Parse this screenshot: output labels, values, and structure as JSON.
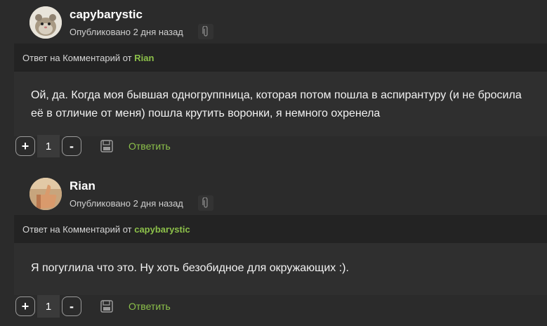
{
  "comments": [
    {
      "author": "capybarystic",
      "published": "Опубликовано 2 дня назад",
      "reply_prefix": "Ответ на Комментарий от ",
      "reply_to": "Rian",
      "text": "Ой, да. Когда моя бывшая одногруппница, которая потом пошла в аспирантуру (и не бросила её в отличие от меня) пошла крутить воронки, я немного охренела",
      "vote_plus": "+",
      "vote_count": "1",
      "vote_minus": "-",
      "reply_label": "Ответить"
    },
    {
      "author": "Rian",
      "published": "Опубликовано 2 дня назад",
      "reply_prefix": "Ответ на Комментарий от ",
      "reply_to": "capybarystic",
      "text": "Я погуглила что это. Ну хоть безобидное для окружающих :).",
      "vote_plus": "+",
      "vote_count": "1",
      "vote_minus": "-",
      "reply_label": "Ответить"
    }
  ],
  "colors": {
    "background": "#2b2b2b",
    "reply_bar": "#232323",
    "accent_green": "#8cc04a"
  },
  "icons": {
    "attachment": "paperclip-icon",
    "save": "floppy-disk-icon"
  }
}
